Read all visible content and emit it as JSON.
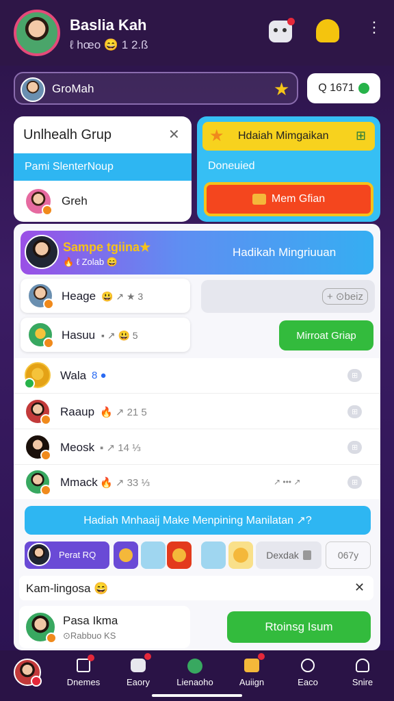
{
  "header": {
    "name": "Baslia Kah",
    "sub": "ℓ hœo 😄 1 2.ß"
  },
  "group_bar": {
    "name": "GroMah",
    "coins": "Q 1671"
  },
  "left_card": {
    "title": "Unlhealh Grup",
    "blue_label": "Pami SlenterNoup",
    "member": "Greh"
  },
  "right_card": {
    "header": "Hdaiah Mimgaikan",
    "label": "Doneuied",
    "button": "Mem Gfian"
  },
  "banner": {
    "title": "Sampe tgiina★",
    "sub": "🔥 ℓ Zolab 😄",
    "button": "Hadikah Mingriuuan"
  },
  "upper_rows": [
    {
      "name": "Heage",
      "meta": "😃 ↗ ★ 3"
    },
    {
      "name": "Hasuu",
      "meta": "▪ ↗ 😃 5"
    }
  ],
  "search_pill": "+ ⊙beiz",
  "green_btn": "Mirroat Griap",
  "list": [
    {
      "name": "Wala",
      "meta": "8 ●",
      "tag": "⊞"
    },
    {
      "name": "Raaup",
      "meta": "🔥 ↗ 21 5",
      "tag": "⊞"
    },
    {
      "name": "Meosk",
      "meta": "▪ ↗ 14 ⅓",
      "tag": "⊞"
    },
    {
      "name": "Mmack",
      "meta": "🔥 ↗ 33 ⅓",
      "tag": "⊞"
    }
  ],
  "list_dots": "↗ ••• ↗",
  "cta": "Hadiah Mnhaaij Make Menpining Manilatan ↗?",
  "stickers": {
    "first": "Perat RQ",
    "reply": "Dexdak",
    "count": "067y"
  },
  "section": {
    "title": "Kam-lingosa 😄"
  },
  "bottom_user": {
    "name": "Pasa Ikma",
    "sub": "⊙Rabbuo KS",
    "button": "Rtoinsg Isum"
  },
  "nav": [
    {
      "label": "Dnemes"
    },
    {
      "label": "Eaory"
    },
    {
      "label": "Lienaoho"
    },
    {
      "label": "Auiign"
    },
    {
      "label": "Eaco"
    },
    {
      "label": "Snire"
    }
  ]
}
